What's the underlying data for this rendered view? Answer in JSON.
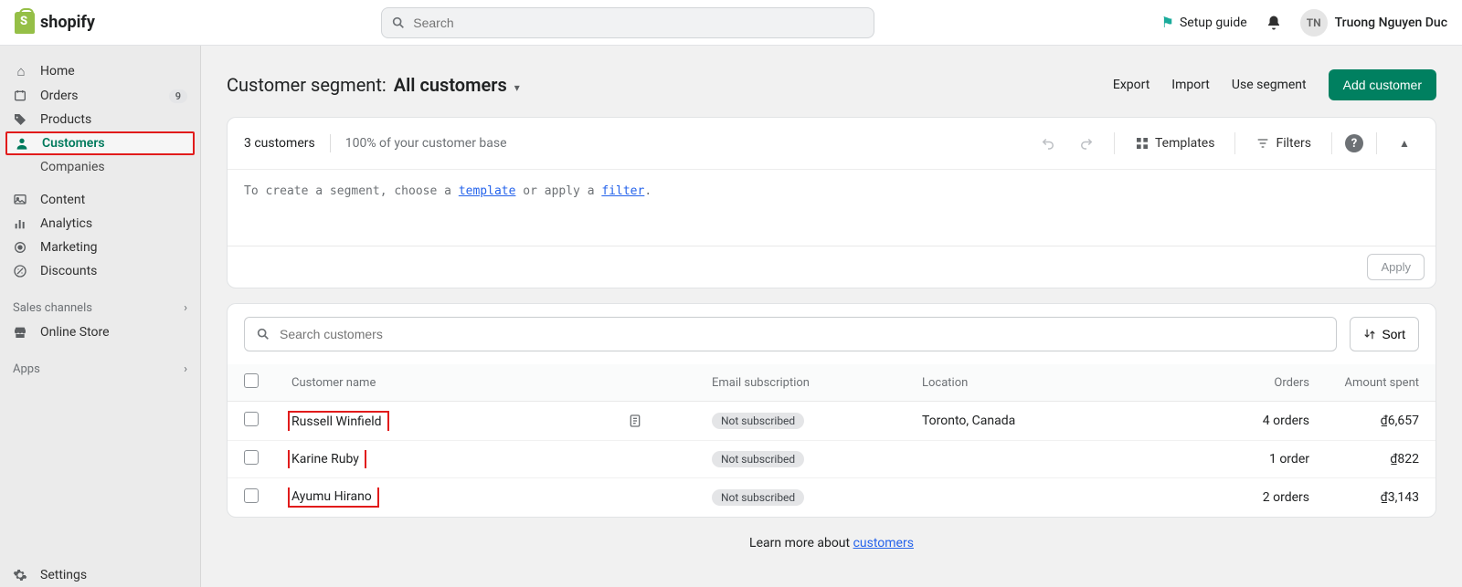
{
  "brand": "shopify",
  "search_placeholder": "Search",
  "setup_guide": "Setup guide",
  "user": {
    "initials": "TN",
    "name": "Truong Nguyen Duc"
  },
  "sidebar": {
    "items": [
      {
        "label": "Home"
      },
      {
        "label": "Orders",
        "badge": "9"
      },
      {
        "label": "Products"
      },
      {
        "label": "Customers"
      },
      {
        "label": "Companies"
      },
      {
        "label": "Content"
      },
      {
        "label": "Analytics"
      },
      {
        "label": "Marketing"
      },
      {
        "label": "Discounts"
      }
    ],
    "sales_channels_heading": "Sales channels",
    "online_store": "Online Store",
    "apps_heading": "Apps",
    "settings": "Settings"
  },
  "page": {
    "title_prefix": "Customer segment:",
    "title_value": "All customers",
    "actions": {
      "export": "Export",
      "import": "Import",
      "use_segment": "Use segment",
      "add_customer": "Add customer"
    }
  },
  "segment_card": {
    "count": "3 customers",
    "base_pct": "100% of your customer base",
    "templates": "Templates",
    "filters": "Filters",
    "editor_pre": "To create a segment, choose a ",
    "editor_link1": "template",
    "editor_mid": " or apply a ",
    "editor_link2": "filter",
    "editor_post": ".",
    "apply": "Apply"
  },
  "table": {
    "search_placeholder": "Search customers",
    "sort": "Sort",
    "headers": {
      "name": "Customer name",
      "sub": "Email subscription",
      "loc": "Location",
      "orders": "Orders",
      "amount": "Amount spent"
    },
    "rows": [
      {
        "name": "Russell Winfield",
        "has_note": true,
        "sub": "Not subscribed",
        "loc": "Toronto, Canada",
        "orders": "4 orders",
        "amount": "₫6,657"
      },
      {
        "name": "Karine Ruby",
        "has_note": false,
        "sub": "Not subscribed",
        "loc": "",
        "orders": "1 order",
        "amount": "₫822"
      },
      {
        "name": "Ayumu Hirano",
        "has_note": false,
        "sub": "Not subscribed",
        "loc": "",
        "orders": "2 orders",
        "amount": "₫3,143"
      }
    ]
  },
  "footer": {
    "pre": "Learn more about ",
    "link": "customers"
  }
}
